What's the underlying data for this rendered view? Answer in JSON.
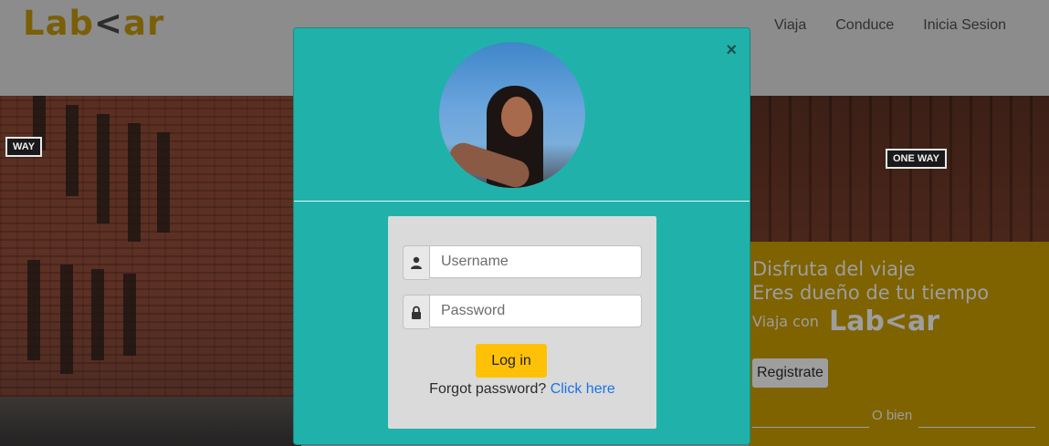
{
  "navbar": {
    "logo_left": "Lab",
    "logo_chevron": "<",
    "logo_right": "ar",
    "links": [
      "Viaja",
      "Conduce",
      "Inicia Sesion"
    ]
  },
  "hero": {
    "sign_left": "WAY",
    "sign_right": "ONE WAY",
    "promo": {
      "line1": "Disfruta del viaje",
      "line2": "Eres dueño de tu tiempo",
      "viaja_con": "Viaja con",
      "logo_left": "Lab",
      "logo_chevron": "<",
      "logo_right": "ar",
      "register_label": "Registrate",
      "or_text": "O bien"
    }
  },
  "modal": {
    "close_symbol": "×",
    "username_placeholder": "Username",
    "password_placeholder": "Password",
    "login_label": "Log in",
    "forgot_text": "Forgot password?",
    "forgot_link": "Click here",
    "icons": [
      "user-icon",
      "lock-icon",
      "close-icon"
    ]
  },
  "colors": {
    "modal_bg": "#20b2aa",
    "login_button": "#ffc107",
    "logo": "#7a5f08",
    "link": "#1a73e8"
  }
}
